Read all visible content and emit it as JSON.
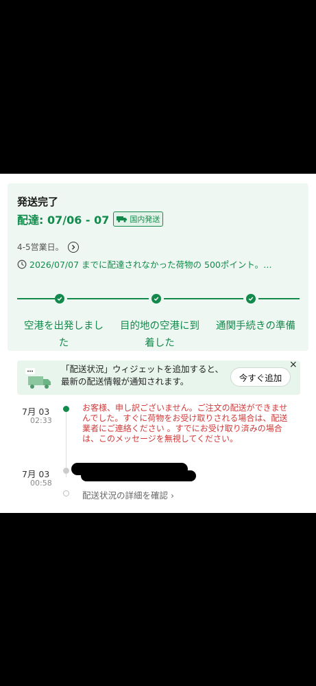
{
  "order": {
    "status_title": "発送完了",
    "delivery_label": "配達: 07/06 - 07",
    "domestic_badge": "国内発送",
    "business_days": "4-5営業日。",
    "guarantee_text": "2026/07/07 までに配達されなかった荷物の 500ポイント。…"
  },
  "progress_steps": [
    {
      "line1": "空港を出発しまし",
      "line2": "た"
    },
    {
      "line1": "目的地の空港に到",
      "line2": "着した"
    },
    {
      "line1": "通関手続きの準備",
      "line2": ""
    }
  ],
  "widget": {
    "message": "「配送状況」ウィジェットを追加すると、最新の配送情報が通知されます。",
    "add_button": "今すぐ追加",
    "close": "×"
  },
  "tracking_events": [
    {
      "date": "7月 03",
      "time": "02:33",
      "text": "お客様、申し訳ございません。ご注文の配送ができませんでした。すぐに荷物をお受け取りされる場合は、配送業者にご連絡ください 。すでにお受け取り済みの場合は、このメッセージを無視してください。"
    },
    {
      "date": "7月 03",
      "time": "00:58",
      "text": ""
    }
  ],
  "detail_link": "配送状況の詳細を確認",
  "colors": {
    "accent": "#138a4c",
    "card_bg": "#eef7f1",
    "alert_text": "#d13a3a"
  }
}
